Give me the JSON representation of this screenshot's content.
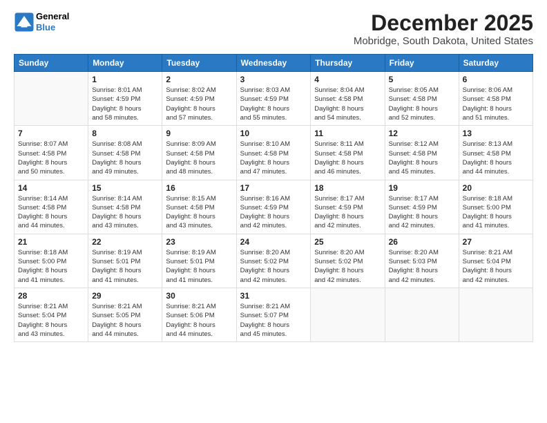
{
  "header": {
    "logo_general": "General",
    "logo_blue": "Blue",
    "month_title": "December 2025",
    "location": "Mobridge, South Dakota, United States"
  },
  "weekdays": [
    "Sunday",
    "Monday",
    "Tuesday",
    "Wednesday",
    "Thursday",
    "Friday",
    "Saturday"
  ],
  "weeks": [
    [
      {
        "day": "",
        "info": ""
      },
      {
        "day": "1",
        "info": "Sunrise: 8:01 AM\nSunset: 4:59 PM\nDaylight: 8 hours\nand 58 minutes."
      },
      {
        "day": "2",
        "info": "Sunrise: 8:02 AM\nSunset: 4:59 PM\nDaylight: 8 hours\nand 57 minutes."
      },
      {
        "day": "3",
        "info": "Sunrise: 8:03 AM\nSunset: 4:59 PM\nDaylight: 8 hours\nand 55 minutes."
      },
      {
        "day": "4",
        "info": "Sunrise: 8:04 AM\nSunset: 4:58 PM\nDaylight: 8 hours\nand 54 minutes."
      },
      {
        "day": "5",
        "info": "Sunrise: 8:05 AM\nSunset: 4:58 PM\nDaylight: 8 hours\nand 52 minutes."
      },
      {
        "day": "6",
        "info": "Sunrise: 8:06 AM\nSunset: 4:58 PM\nDaylight: 8 hours\nand 51 minutes."
      }
    ],
    [
      {
        "day": "7",
        "info": "Sunrise: 8:07 AM\nSunset: 4:58 PM\nDaylight: 8 hours\nand 50 minutes."
      },
      {
        "day": "8",
        "info": "Sunrise: 8:08 AM\nSunset: 4:58 PM\nDaylight: 8 hours\nand 49 minutes."
      },
      {
        "day": "9",
        "info": "Sunrise: 8:09 AM\nSunset: 4:58 PM\nDaylight: 8 hours\nand 48 minutes."
      },
      {
        "day": "10",
        "info": "Sunrise: 8:10 AM\nSunset: 4:58 PM\nDaylight: 8 hours\nand 47 minutes."
      },
      {
        "day": "11",
        "info": "Sunrise: 8:11 AM\nSunset: 4:58 PM\nDaylight: 8 hours\nand 46 minutes."
      },
      {
        "day": "12",
        "info": "Sunrise: 8:12 AM\nSunset: 4:58 PM\nDaylight: 8 hours\nand 45 minutes."
      },
      {
        "day": "13",
        "info": "Sunrise: 8:13 AM\nSunset: 4:58 PM\nDaylight: 8 hours\nand 44 minutes."
      }
    ],
    [
      {
        "day": "14",
        "info": "Sunrise: 8:14 AM\nSunset: 4:58 PM\nDaylight: 8 hours\nand 44 minutes."
      },
      {
        "day": "15",
        "info": "Sunrise: 8:14 AM\nSunset: 4:58 PM\nDaylight: 8 hours\nand 43 minutes."
      },
      {
        "day": "16",
        "info": "Sunrise: 8:15 AM\nSunset: 4:58 PM\nDaylight: 8 hours\nand 43 minutes."
      },
      {
        "day": "17",
        "info": "Sunrise: 8:16 AM\nSunset: 4:59 PM\nDaylight: 8 hours\nand 42 minutes."
      },
      {
        "day": "18",
        "info": "Sunrise: 8:17 AM\nSunset: 4:59 PM\nDaylight: 8 hours\nand 42 minutes."
      },
      {
        "day": "19",
        "info": "Sunrise: 8:17 AM\nSunset: 4:59 PM\nDaylight: 8 hours\nand 42 minutes."
      },
      {
        "day": "20",
        "info": "Sunrise: 8:18 AM\nSunset: 5:00 PM\nDaylight: 8 hours\nand 41 minutes."
      }
    ],
    [
      {
        "day": "21",
        "info": "Sunrise: 8:18 AM\nSunset: 5:00 PM\nDaylight: 8 hours\nand 41 minutes."
      },
      {
        "day": "22",
        "info": "Sunrise: 8:19 AM\nSunset: 5:01 PM\nDaylight: 8 hours\nand 41 minutes."
      },
      {
        "day": "23",
        "info": "Sunrise: 8:19 AM\nSunset: 5:01 PM\nDaylight: 8 hours\nand 41 minutes."
      },
      {
        "day": "24",
        "info": "Sunrise: 8:20 AM\nSunset: 5:02 PM\nDaylight: 8 hours\nand 42 minutes."
      },
      {
        "day": "25",
        "info": "Sunrise: 8:20 AM\nSunset: 5:02 PM\nDaylight: 8 hours\nand 42 minutes."
      },
      {
        "day": "26",
        "info": "Sunrise: 8:20 AM\nSunset: 5:03 PM\nDaylight: 8 hours\nand 42 minutes."
      },
      {
        "day": "27",
        "info": "Sunrise: 8:21 AM\nSunset: 5:04 PM\nDaylight: 8 hours\nand 42 minutes."
      }
    ],
    [
      {
        "day": "28",
        "info": "Sunrise: 8:21 AM\nSunset: 5:04 PM\nDaylight: 8 hours\nand 43 minutes."
      },
      {
        "day": "29",
        "info": "Sunrise: 8:21 AM\nSunset: 5:05 PM\nDaylight: 8 hours\nand 44 minutes."
      },
      {
        "day": "30",
        "info": "Sunrise: 8:21 AM\nSunset: 5:06 PM\nDaylight: 8 hours\nand 44 minutes."
      },
      {
        "day": "31",
        "info": "Sunrise: 8:21 AM\nSunset: 5:07 PM\nDaylight: 8 hours\nand 45 minutes."
      },
      {
        "day": "",
        "info": ""
      },
      {
        "day": "",
        "info": ""
      },
      {
        "day": "",
        "info": ""
      }
    ]
  ]
}
